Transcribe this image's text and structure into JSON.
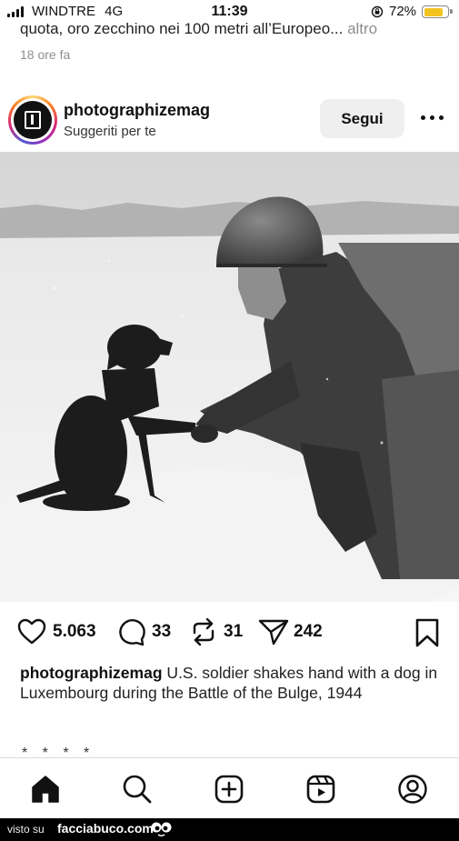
{
  "status_bar": {
    "carrier": "WINDTRE",
    "network": "4G",
    "time": "11:39",
    "battery": "72%",
    "battery_level": 0.72,
    "battery_color": "#f3c320"
  },
  "previous_post": {
    "caption_text": "quota, oro zecchino nei 100 metri all’Europeo...",
    "more_label": "altro",
    "timestamp": "18 ore fa"
  },
  "post": {
    "username": "photographizemag",
    "subtitle": "Suggeriti per te",
    "follow_label": "Segui",
    "image_icon": "photo-soldier-dog",
    "actions": {
      "likes": "5.063",
      "comments": "33",
      "reposts": "31",
      "shares": "242"
    },
    "caption": {
      "username": "photographizemag",
      "text": "U.S. soldier shakes hand with a dog in Luxembourg during the Battle of the Bulge, 1944",
      "tail": "* * * *"
    }
  },
  "bottom_nav": {
    "items": [
      "home-icon",
      "search-icon",
      "create-icon",
      "reels-icon",
      "profile-icon"
    ]
  },
  "watermark": {
    "prefix": "visto su",
    "site": "facciabuco.com"
  }
}
